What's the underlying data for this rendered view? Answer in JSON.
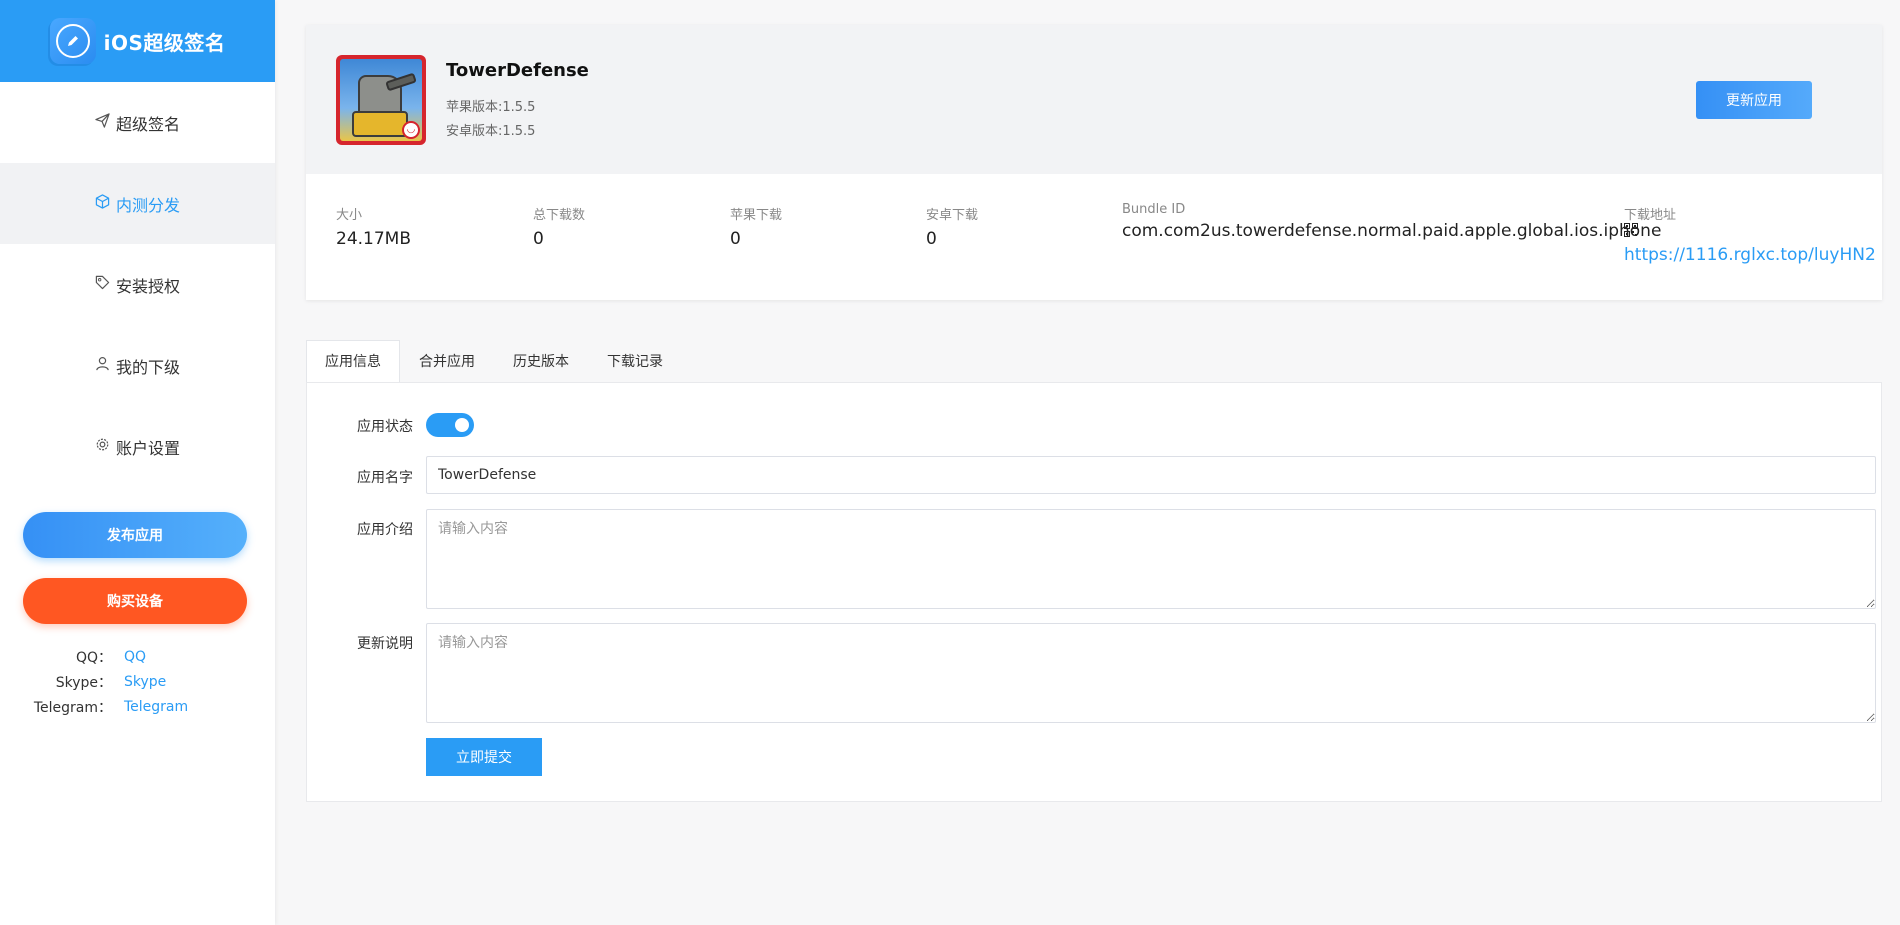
{
  "brand": {
    "title": "iOS超级签名"
  },
  "sidebar": {
    "items": [
      {
        "label": "超级签名",
        "icon": "send-icon"
      },
      {
        "label": "内测分发",
        "icon": "cube-icon"
      },
      {
        "label": "安装授权",
        "icon": "tag-icon"
      },
      {
        "label": "我的下级",
        "icon": "user-icon"
      },
      {
        "label": "账户设置",
        "icon": "gear-icon"
      }
    ],
    "active_index": 1,
    "publish_label": "发布应用",
    "buy_label": "购买设备",
    "contacts": [
      {
        "key": "QQ：",
        "value": "QQ"
      },
      {
        "key": "Skype：",
        "value": "Skype"
      },
      {
        "key": "Telegram：",
        "value": "Telegram"
      }
    ]
  },
  "app": {
    "name": "TowerDefense",
    "ios_version": "苹果版本:1.5.5",
    "android_version": "安卓版本:1.5.5",
    "update_label": "更新应用",
    "stats": {
      "size_label": "大小",
      "size": "24.17MB",
      "total_label": "总下载数",
      "total": "0",
      "ios_label": "苹果下载",
      "ios": "0",
      "android_label": "安卓下载",
      "android": "0",
      "bundle_label": "Bundle ID",
      "bundle": "com.com2us.towerdefense.normal.paid.apple.global.ios.iphone",
      "url_label": "下载地址",
      "url": "https://1116.rglxc.top/luyHN2"
    }
  },
  "tabs": [
    "应用信息",
    "合并应用",
    "历史版本",
    "下载记录"
  ],
  "form": {
    "status_label": "应用状态",
    "status_on": true,
    "name_label": "应用名字",
    "name_value": "TowerDefense",
    "intro_label": "应用介绍",
    "intro_placeholder": "请输入内容",
    "notes_label": "更新说明",
    "notes_placeholder": "请输入内容",
    "submit_label": "立即提交"
  },
  "colors": {
    "accent": "#2a9cf5",
    "buy": "#ff5722"
  }
}
